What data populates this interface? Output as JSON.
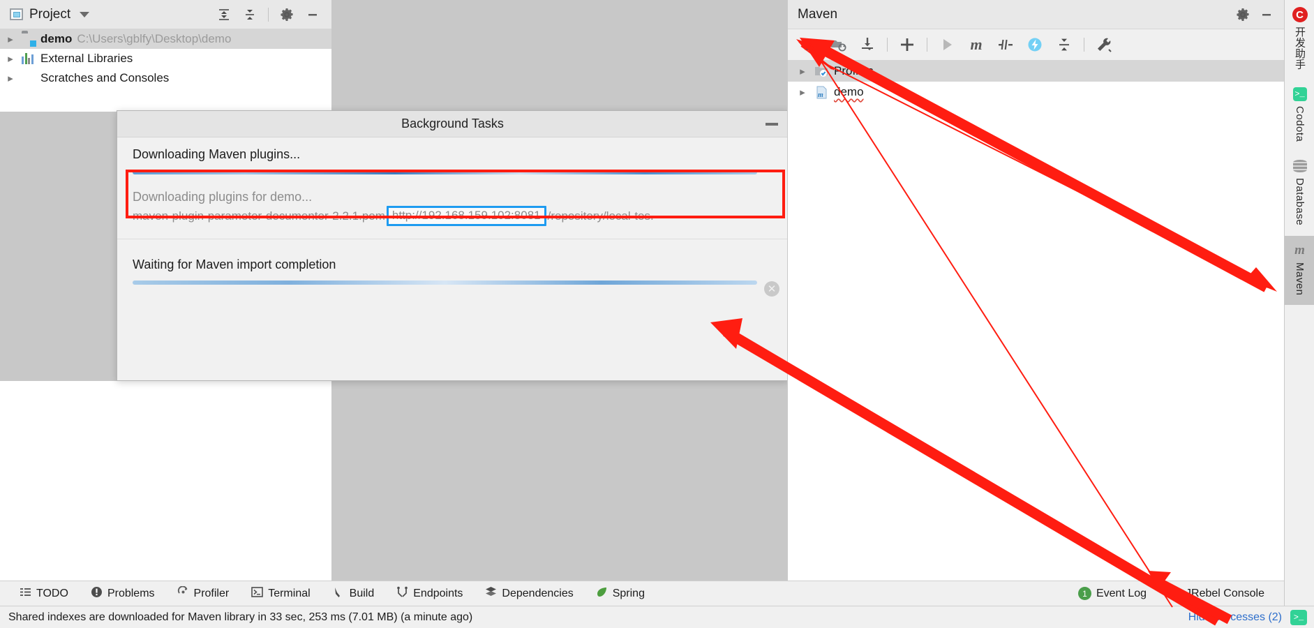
{
  "project_panel": {
    "title": "Project",
    "icons": {
      "project": "project-icon",
      "chevron": "chevron-down-icon",
      "expand_all": "expand-all-icon",
      "collapse_all": "collapse-all-icon",
      "settings": "gear-icon",
      "hide": "minimize-icon"
    },
    "tree": [
      {
        "label": "demo",
        "path": "C:\\Users\\gblfy\\Desktop\\demo",
        "icon": "folder-module-icon",
        "selected": true,
        "bold": true
      },
      {
        "label": "External Libraries",
        "path": "",
        "icon": "library-icon",
        "selected": false,
        "bold": false
      },
      {
        "label": "Scratches and Consoles",
        "path": "",
        "icon": "scratches-icon",
        "selected": false,
        "bold": false
      }
    ]
  },
  "background_tasks": {
    "title": "Background Tasks",
    "minimize_icon": "minimize-icon",
    "tasks": [
      {
        "label": "Downloading Maven plugins...",
        "progress_style": "indeterminate"
      },
      {
        "label": "Downloading plugins for demo...",
        "detail_prefix": "maven-plugin-parameter-documenter-2.2.1.pom ",
        "detail_url": "http://192.168.159.102:8081",
        "detail_suffix": "/repository/local-tes.",
        "cancel_icon": "cancel-icon"
      },
      {
        "label": "Waiting for Maven import completion",
        "progress_style": "indeterminate"
      }
    ]
  },
  "maven_panel": {
    "title": "Maven",
    "header_icons": {
      "settings": "gear-icon",
      "hide": "minimize-icon"
    },
    "toolbar": [
      {
        "name": "reload-all-maven-projects-icon",
        "glyph": "↻"
      },
      {
        "name": "generate-sources-and-update-folders-icon",
        "glyph": "folder-refresh"
      },
      {
        "name": "download-sources-and-documentation-icon",
        "glyph": "download"
      },
      {
        "name": "add-maven-project-icon",
        "glyph": "+"
      },
      {
        "name": "run-maven-build-icon",
        "glyph": "▶"
      },
      {
        "name": "execute-maven-goal-icon",
        "glyph": "m"
      },
      {
        "name": "toggle-skip-tests-icon",
        "glyph": "skip-tests"
      },
      {
        "name": "toggle-offline-mode-icon",
        "glyph": "⚡"
      },
      {
        "name": "collapse-all-icon",
        "glyph": "collapse"
      },
      {
        "name": "maven-settings-icon",
        "glyph": "wrench"
      }
    ],
    "tree": [
      {
        "label": "Profiles",
        "icon": "profiles-icon",
        "selected": true,
        "error": false
      },
      {
        "label": "demo",
        "icon": "maven-project-icon",
        "selected": false,
        "error": true
      }
    ]
  },
  "right_tool_strip": [
    {
      "label": "开发助手",
      "icon": "assistant-icon",
      "active": false
    },
    {
      "label": "Codota",
      "icon": "codota-icon",
      "active": false
    },
    {
      "label": "Database",
      "icon": "database-icon",
      "active": false
    },
    {
      "label": "Maven",
      "icon": "maven-icon",
      "active": true
    }
  ],
  "bottom_tool_bar": [
    {
      "label": "TODO",
      "icon": "todo-icon"
    },
    {
      "label": "Problems",
      "icon": "problems-icon"
    },
    {
      "label": "Profiler",
      "icon": "profiler-icon"
    },
    {
      "label": "Terminal",
      "icon": "terminal-icon"
    },
    {
      "label": "Build",
      "icon": "build-icon"
    },
    {
      "label": "Endpoints",
      "icon": "endpoints-icon"
    },
    {
      "label": "Dependencies",
      "icon": "dependencies-icon"
    },
    {
      "label": "Spring",
      "icon": "spring-icon"
    }
  ],
  "bottom_tool_bar_right": [
    {
      "label": "Event Log",
      "icon": "event-log-icon",
      "badge": "1"
    },
    {
      "label": "JRebel Console",
      "icon": "jrebel-icon",
      "badge": ""
    }
  ],
  "status_bar": {
    "message": "Shared indexes are downloaded for Maven library in 33 sec, 253 ms (7.01 MB) (a minute ago)",
    "hide_processes": "Hide processes (2)",
    "terminal_icon": "terminal-icon"
  },
  "colors": {
    "annotation_red": "#ff1d11",
    "highlight_blue": "#1e9bf0",
    "accent_link": "#2d6ecb",
    "panel_bg": "#f0f0f0",
    "editor_bg": "#c8c8c8"
  }
}
